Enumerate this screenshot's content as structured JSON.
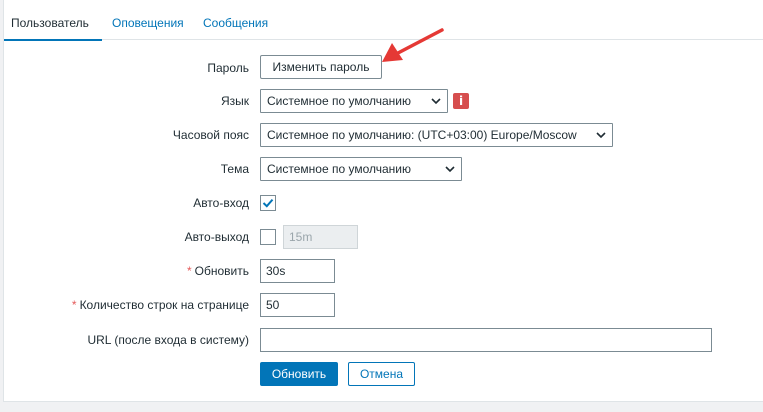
{
  "tabs": [
    {
      "label": "Пользователь",
      "active": true
    },
    {
      "label": "Оповещения",
      "active": false
    },
    {
      "label": "Сообщения",
      "active": false
    }
  ],
  "form": {
    "password": {
      "label": "Пароль",
      "button": "Изменить пароль"
    },
    "language": {
      "label": "Язык",
      "value": "Системное по умолчанию",
      "info_icon": "i"
    },
    "timezone": {
      "label": "Часовой пояс",
      "value": "Системное по умолчанию: (UTC+03:00) Europe/Moscow"
    },
    "theme": {
      "label": "Тема",
      "value": "Системное по умолчанию"
    },
    "autologin": {
      "label": "Авто-вход",
      "checked": true
    },
    "autologout": {
      "label": "Авто-выход",
      "checked": false,
      "value": "15m"
    },
    "refresh": {
      "label": "Обновить",
      "required_mark": "*",
      "value": "30s"
    },
    "rows_per_page": {
      "label": "Количество строк на странице",
      "required_mark": "*",
      "value": "50"
    },
    "url": {
      "label": "URL (после входа в систему)",
      "value": ""
    }
  },
  "actions": {
    "submit": "Обновить",
    "cancel": "Отмена"
  },
  "colors": {
    "accent": "#0275b8",
    "annotation_arrow": "#e53935",
    "info": "#d64e4e"
  },
  "annotation": {
    "icon": "red-arrow-pointing-to-change-password"
  }
}
